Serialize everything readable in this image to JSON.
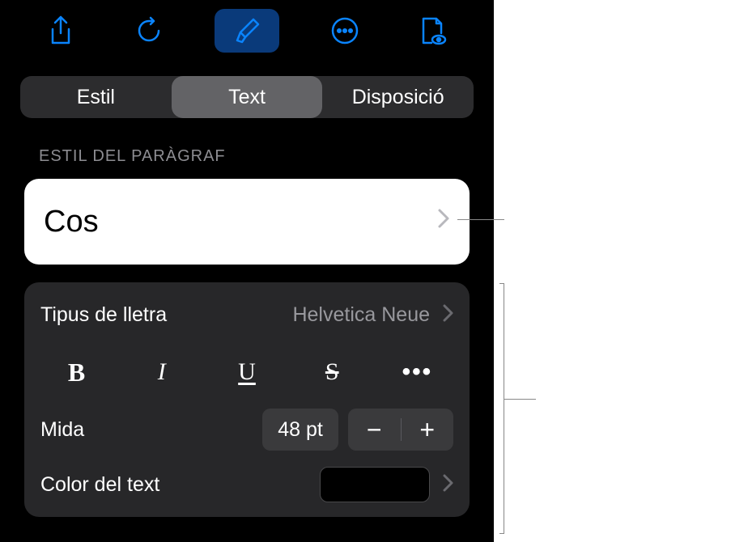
{
  "toolbar": {
    "icons": [
      "share",
      "undo",
      "format",
      "more",
      "document"
    ]
  },
  "tabs": {
    "style": "Estil",
    "text": "Text",
    "layout": "Disposició",
    "selected": "text"
  },
  "paragraph": {
    "header": "ESTIL DEL PARÀGRAF",
    "style_name": "Cos"
  },
  "font": {
    "label": "Tipus de lletra",
    "value": "Helvetica Neue"
  },
  "format_buttons": {
    "bold": "B",
    "italic": "I",
    "underline": "U",
    "strike": "S",
    "more": "•••"
  },
  "size": {
    "label": "Mida",
    "value": "48 pt",
    "minus": "−",
    "plus": "+"
  },
  "text_color": {
    "label": "Color del text",
    "value_hex": "#000000"
  }
}
